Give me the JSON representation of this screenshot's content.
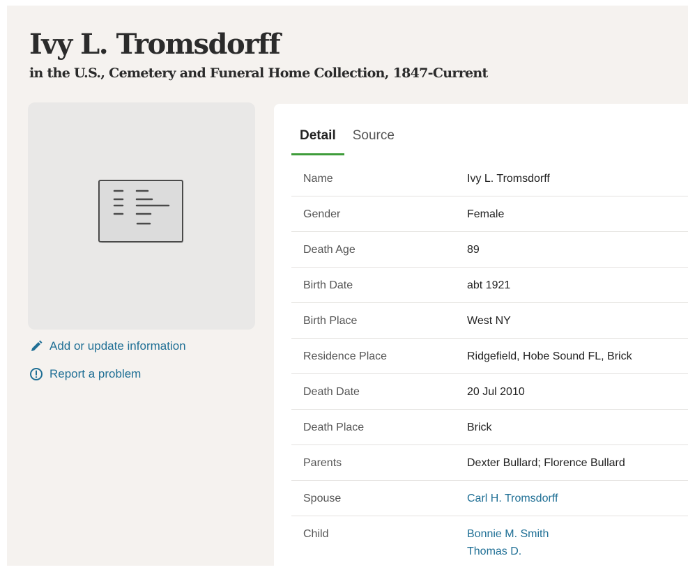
{
  "header": {
    "title": "Ivy L. Tromsdorff",
    "subtitle": "in the U.S., Cemetery and Funeral Home Collection, 1847-Current"
  },
  "sidebar": {
    "image_icon": "document-record-icon",
    "add_update_label": "Add or update information",
    "report_problem_label": "Report a problem"
  },
  "tabs": [
    {
      "label": "Detail",
      "active": true
    },
    {
      "label": "Source",
      "active": false
    }
  ],
  "details": [
    {
      "label": "Name",
      "value": "Ivy L. Tromsdorff"
    },
    {
      "label": "Gender",
      "value": "Female"
    },
    {
      "label": "Death Age",
      "value": "89"
    },
    {
      "label": "Birth Date",
      "value": "abt 1921"
    },
    {
      "label": "Birth Place",
      "value": "West NY"
    },
    {
      "label": "Residence Place",
      "value": "Ridgefield, Hobe Sound FL, Brick"
    },
    {
      "label": "Death Date",
      "value": "20 Jul 2010"
    },
    {
      "label": "Death Place",
      "value": "Brick"
    },
    {
      "label": "Parents",
      "value": "Dexter Bullard; Florence Bullard"
    },
    {
      "label": "Spouse",
      "value": "Carl H. Tromsdorff"
    },
    {
      "label": "Child",
      "value": "Bonnie M. Smith",
      "value2": "Thomas D."
    }
  ],
  "colors": {
    "accent_link": "#1f6f95",
    "tab_underline": "#3e9c3a",
    "page_bg": "#f5f2ef"
  }
}
